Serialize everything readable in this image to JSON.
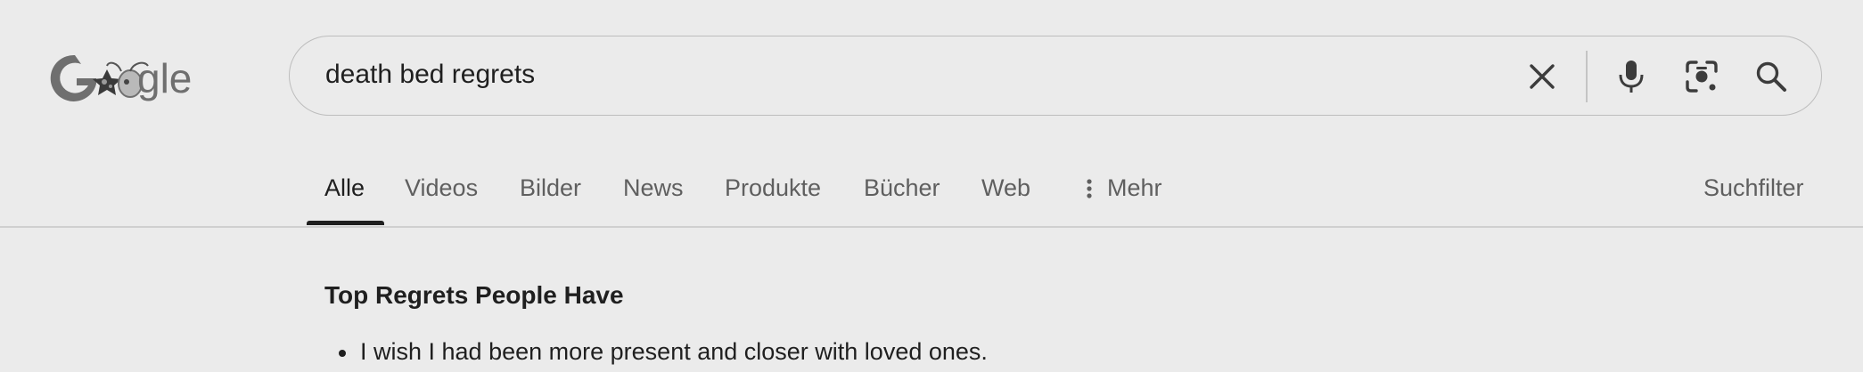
{
  "logo": {
    "text": "Google",
    "alt": "Google Doodle"
  },
  "search": {
    "query": "death bed regrets",
    "icons": [
      "close-icon",
      "microphone-icon",
      "camera-lens-icon",
      "search-icon"
    ]
  },
  "tabs": [
    {
      "label": "Alle",
      "active": true
    },
    {
      "label": "Videos",
      "active": false
    },
    {
      "label": "Bilder",
      "active": false
    },
    {
      "label": "News",
      "active": false
    },
    {
      "label": "Produkte",
      "active": false
    },
    {
      "label": "Bücher",
      "active": false
    },
    {
      "label": "Web",
      "active": false
    },
    {
      "label": "Mehr",
      "active": false,
      "icon": "more-vertical-icon"
    }
  ],
  "filter_label": "Suchfilter",
  "result": {
    "heading": "Top Regrets People Have",
    "items": [
      "I wish I had been more present and closer with loved ones."
    ]
  },
  "colors": {
    "background": "#ebebeb",
    "text": "#1f1f1f",
    "muted": "#5f5f5f"
  }
}
